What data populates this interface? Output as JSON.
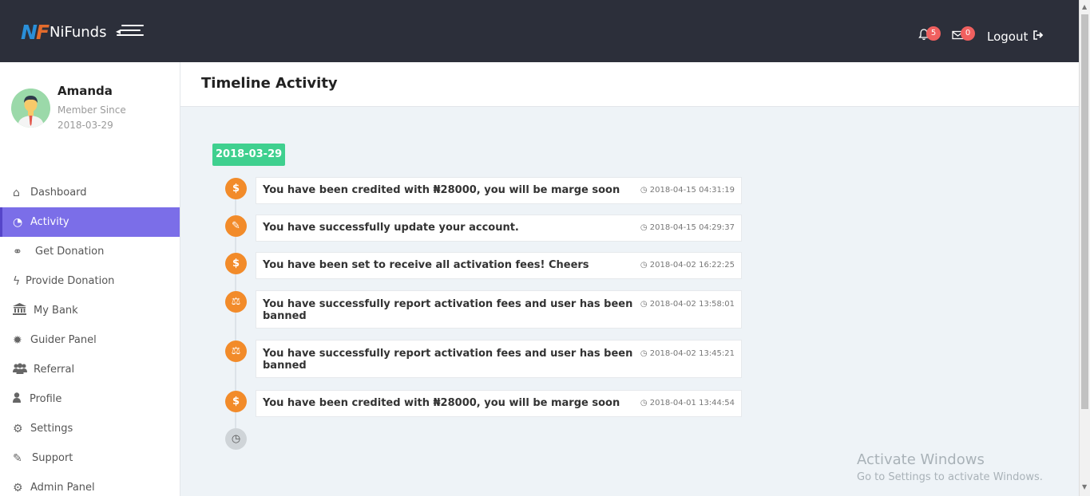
{
  "app": {
    "logo_mark_a": "N",
    "logo_mark_b": "F",
    "logo_text": "NiFunds"
  },
  "topbar": {
    "notifications_count": "5",
    "messages_count": "0",
    "logout_label": "Logout"
  },
  "user": {
    "name": "Amanda",
    "member_label": "Member Since",
    "member_date": "2018-03-29"
  },
  "sidebar": {
    "items": [
      {
        "label": "Dashboard",
        "icon": "home-icon",
        "glyph": "⌂"
      },
      {
        "label": "Activity",
        "icon": "pie-chart-icon",
        "glyph": "◔"
      },
      {
        "label": "Get Donation",
        "icon": "handshake-icon",
        "glyph": "⚭"
      },
      {
        "label": "Provide Donation",
        "icon": "bolt-icon",
        "glyph": "ϟ"
      },
      {
        "label": "My Bank",
        "icon": "bank-icon",
        "glyph": "🏛"
      },
      {
        "label": "Guider Panel",
        "icon": "badge-icon",
        "glyph": "✹"
      },
      {
        "label": "Referral",
        "icon": "users-icon",
        "glyph": "👥"
      },
      {
        "label": "Profile",
        "icon": "user-icon",
        "glyph": "●"
      },
      {
        "label": "Settings",
        "icon": "gear-icon",
        "glyph": "⚙"
      },
      {
        "label": "Support",
        "icon": "ticket-icon",
        "glyph": "✎"
      },
      {
        "label": "Admin Panel",
        "icon": "gear-icon",
        "glyph": "⚙"
      }
    ],
    "active_index": 1
  },
  "page": {
    "title": "Timeline Activity"
  },
  "timeline": {
    "date_tag": "2018-03-29",
    "entries": [
      {
        "icon": "dollar-icon",
        "glyph": "$",
        "text_line1": "You have been credited with ₦28000, you will be marge soon",
        "text_line2": "",
        "time": "2018-04-15 04:31:19"
      },
      {
        "icon": "edit-icon",
        "glyph": "✎",
        "text_line1": "You have successfully update your account.",
        "text_line2": "",
        "time": "2018-04-15 04:29:37"
      },
      {
        "icon": "dollar-icon",
        "glyph": "$",
        "text_line1": "You have been set to receive all activation fees! Cheers",
        "text_line2": "",
        "time": "2018-04-02 16:22:25"
      },
      {
        "icon": "gavel-icon",
        "glyph": "⚖",
        "text_line1": "You have successfully report activation fees and user has been",
        "text_line2": "banned",
        "time": "2018-04-02 13:58:01"
      },
      {
        "icon": "gavel-icon",
        "glyph": "⚖",
        "text_line1": "You have successfully report activation fees and user has been",
        "text_line2": "banned",
        "time": "2018-04-02 13:45:21"
      },
      {
        "icon": "dollar-icon",
        "glyph": "$",
        "text_line1": "You have been credited with ₦28000, you will be marge soon",
        "text_line2": "",
        "time": "2018-04-01 13:44:54"
      }
    ],
    "end_icon": "clock-icon",
    "end_glyph": "◷"
  },
  "watermark": {
    "line1": "Activate Windows",
    "line2": "Go to Settings to activate Windows."
  },
  "colors": {
    "topbar": "#2c2f3a",
    "accent": "#7b6ee8",
    "timeline_icon": "#f28b2a",
    "date_tag": "#3fd08f",
    "badge": "#f0605f"
  }
}
